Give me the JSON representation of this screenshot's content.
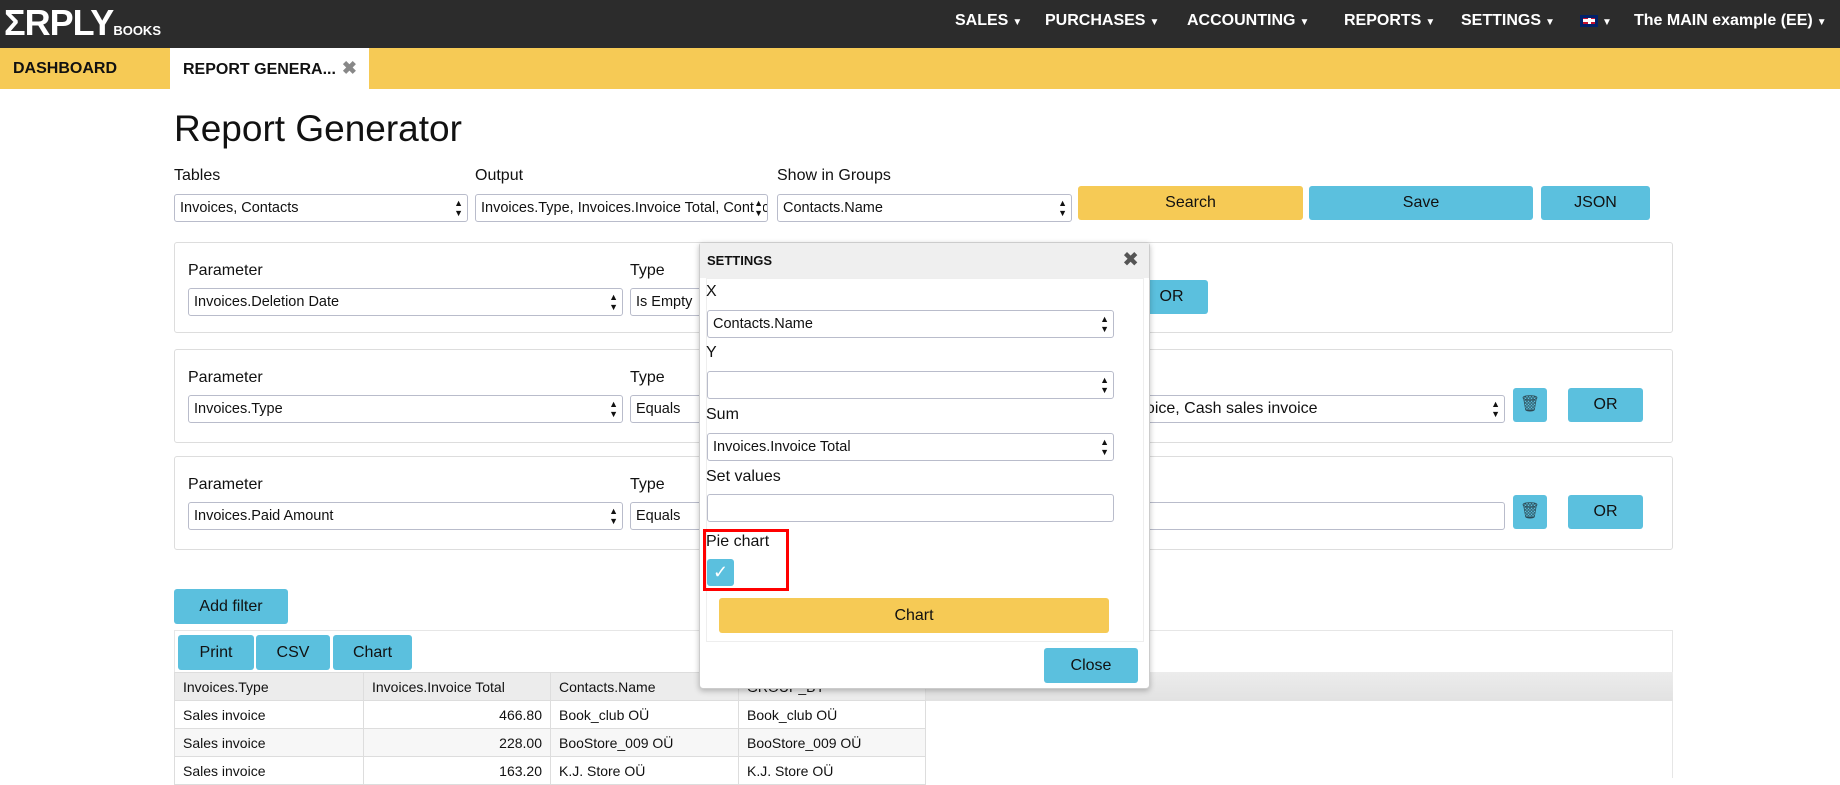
{
  "header": {
    "logo": "ΣRPLY",
    "logo_sub": "BOOKS",
    "nav": [
      {
        "label": "SALES"
      },
      {
        "label": "PURCHASES"
      },
      {
        "label": "ACCOUNTING"
      },
      {
        "label": "REPORTS"
      },
      {
        "label": "SETTINGS"
      }
    ],
    "language_flag": "uk-flag-icon",
    "company": "The MAIN example (EE)"
  },
  "tabs": [
    {
      "label": "DASHBOARD"
    },
    {
      "label": "REPORT GENERA..."
    }
  ],
  "page_title": "Report Generator",
  "query": {
    "tables_label": "Tables",
    "tables_value": "Invoices, Contacts",
    "output_label": "Output",
    "output_value": "Invoices.Type, Invoices.Invoice Total, Contacts.Name",
    "groups_label": "Show in Groups",
    "groups_value": "Contacts.Name",
    "search": "Search",
    "save": "Save",
    "json": "JSON"
  },
  "filters": [
    {
      "param_label": "Parameter",
      "param": "Invoices.Deletion Date",
      "type_label": "Type",
      "type": "Is Empty",
      "value": "",
      "or": "OR"
    },
    {
      "param_label": "Parameter",
      "param": "Invoices.Type",
      "type_label": "Type",
      "type": "Equals",
      "value": "Sales invoice, Cash sales invoice",
      "or": "OR"
    },
    {
      "param_label": "Parameter",
      "param": "Invoices.Paid Amount",
      "type_label": "Type",
      "type": "Equals",
      "value": "",
      "or": "OR"
    }
  ],
  "add_filter": "Add filter",
  "results": {
    "print": "Print",
    "csv": "CSV",
    "chart": "Chart",
    "columns": [
      "Invoices.Type",
      "Invoices.Invoice Total",
      "Contacts.Name",
      "GROUP_BY"
    ],
    "rows": [
      [
        "Sales invoice",
        "466.80",
        "Book_club OÜ",
        "Book_club OÜ"
      ],
      [
        "Sales invoice",
        "228.00",
        "BooStore_009 OÜ",
        "BooStore_009 OÜ"
      ],
      [
        "Sales invoice",
        "163.20",
        "K.J. Store OÜ",
        "K.J. Store OÜ"
      ]
    ]
  },
  "settings_modal": {
    "title": "SETTINGS",
    "x_label": "X",
    "x_value": "Contacts.Name",
    "y_label": "Y",
    "y_value": "",
    "sum_label": "Sum",
    "sum_value": "Invoices.Invoice Total",
    "set_values_label": "Set values",
    "set_values_value": "",
    "pie_chart_label": "Pie chart",
    "pie_chart_checked": true,
    "chart_button": "Chart",
    "close_button": "Close"
  },
  "colors": {
    "topbar": "#2c2c2c",
    "accent_yellow": "#f6ca55",
    "accent_blue": "#5bc0de",
    "highlight": "#ff0000"
  }
}
